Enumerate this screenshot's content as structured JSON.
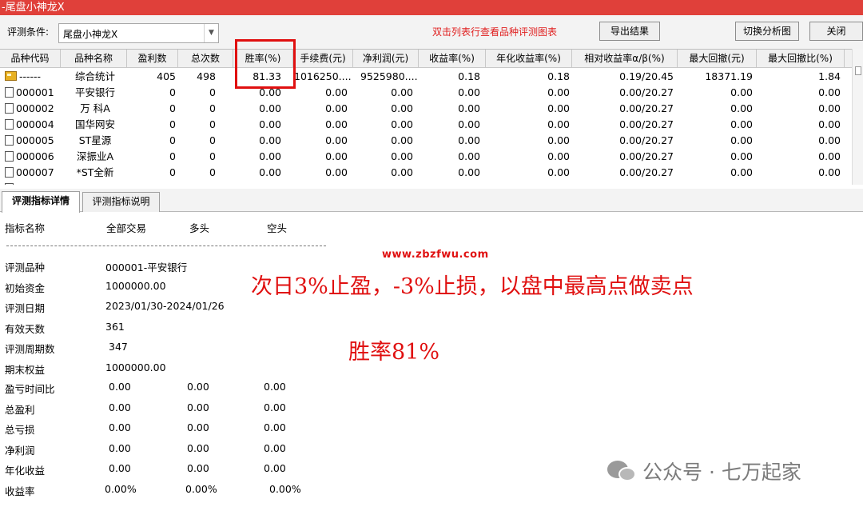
{
  "window": {
    "title": "-尾盘小神龙X"
  },
  "toolbar": {
    "condition_label": "评测条件:",
    "condition_value": "尾盘小神龙X",
    "hint": "双击列表行查看品种评测图表",
    "export_label": "导出结果",
    "switch_label": "切换分析图",
    "close_label": "关闭"
  },
  "table": {
    "headers": [
      "品种代码",
      "品种名称",
      "盈利数",
      "总次数",
      "胜率(%)",
      "手续费(元)",
      "净利润(元)",
      "收益率(%)",
      "年化收益率(%)",
      "相对收益率α/β(%)",
      "最大回撤(元)",
      "最大回撤比(%)"
    ],
    "summary": [
      "------",
      "综合统计",
      "405",
      "498",
      "81.33",
      "1016250....",
      "9525980....",
      "0.18",
      "0.18",
      "0.19/20.45",
      "18371.19",
      "1.84"
    ],
    "rows": [
      [
        "000001",
        "平安银行",
        "0",
        "0",
        "0.00",
        "0.00",
        "0.00",
        "0.00",
        "0.00",
        "0.00/20.27",
        "0.00",
        "0.00"
      ],
      [
        "000002",
        "万 科A",
        "0",
        "0",
        "0.00",
        "0.00",
        "0.00",
        "0.00",
        "0.00",
        "0.00/20.27",
        "0.00",
        "0.00"
      ],
      [
        "000004",
        "国华网安",
        "0",
        "0",
        "0.00",
        "0.00",
        "0.00",
        "0.00",
        "0.00",
        "0.00/20.27",
        "0.00",
        "0.00"
      ],
      [
        "000005",
        "ST星源",
        "0",
        "0",
        "0.00",
        "0.00",
        "0.00",
        "0.00",
        "0.00",
        "0.00/20.27",
        "0.00",
        "0.00"
      ],
      [
        "000006",
        "深振业A",
        "0",
        "0",
        "0.00",
        "0.00",
        "0.00",
        "0.00",
        "0.00",
        "0.00/20.27",
        "0.00",
        "0.00"
      ],
      [
        "000007",
        "*ST全新",
        "0",
        "0",
        "0.00",
        "0.00",
        "0.00",
        "0.00",
        "0.00",
        "0.00/20.27",
        "0.00",
        "0.00"
      ]
    ]
  },
  "tabs": {
    "details": "评测指标详情",
    "explain": "评测指标说明"
  },
  "detail": {
    "header": {
      "name": "指标名称",
      "all": "全部交易",
      "long": "多头",
      "short": "空头"
    },
    "info": [
      {
        "label": "评测品种",
        "value": "000001-平安银行"
      },
      {
        "label": "初始资金",
        "value": "1000000.00"
      },
      {
        "label": "评测日期",
        "value": "2023/01/30-2024/01/26"
      },
      {
        "label": "有效天数",
        "value": "361"
      },
      {
        "label": "评测周期数",
        "value": "347"
      },
      {
        "label": "期末权益",
        "value": "1000000.00"
      }
    ],
    "metrics": [
      {
        "label": "盈亏时间比",
        "all": "0.00",
        "long": "0.00",
        "short": "0.00"
      },
      {
        "label": "总盈利",
        "all": "0.00",
        "long": "0.00",
        "short": "0.00"
      },
      {
        "label": "总亏损",
        "all": "0.00",
        "long": "0.00",
        "short": "0.00"
      },
      {
        "label": "净利润",
        "all": "0.00",
        "long": "0.00",
        "short": "0.00"
      },
      {
        "label": "年化收益",
        "all": "0.00",
        "long": "0.00",
        "short": "0.00"
      },
      {
        "label": "收益率",
        "all": "0.00%",
        "long": "0.00%",
        "short": "0.00%"
      }
    ]
  },
  "overlay": {
    "site": "www.zbzfwu.com",
    "rule": "次日3%止盈，-3%止损，以盘中最高点做卖点",
    "winrate": "胜率81%",
    "watermark": "公众号 · 七万起家"
  }
}
